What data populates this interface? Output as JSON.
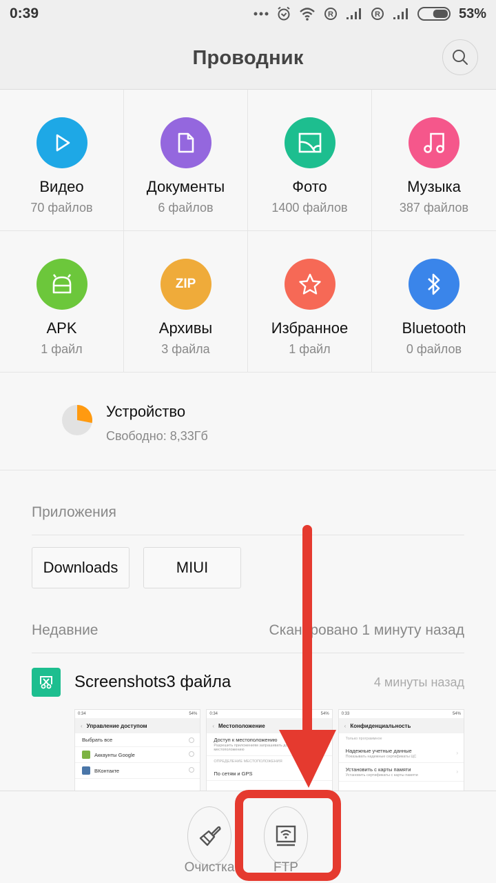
{
  "status_bar": {
    "time": "0:39",
    "battery_percent": "53%",
    "battery_level": 0.53,
    "icons": [
      "more-dots-icon",
      "alarm-icon",
      "wifi-icon",
      "roaming-icon",
      "signal-icon",
      "roaming-icon",
      "signal-icon",
      "battery-icon"
    ]
  },
  "header": {
    "title": "Проводник",
    "search_icon": "search-icon"
  },
  "categories": [
    {
      "name": "Видео",
      "count": "70 файлов",
      "icon": "play-icon",
      "color": "#1ea8e6"
    },
    {
      "name": "Документы",
      "count": "6 файлов",
      "icon": "document-icon",
      "color": "#9467de"
    },
    {
      "name": "Фото",
      "count": "1400 файлов",
      "icon": "photo-icon",
      "color": "#1dbe8f"
    },
    {
      "name": "Музыка",
      "count": "387 файлов",
      "icon": "music-icon",
      "color": "#f5578b"
    },
    {
      "name": "APK",
      "count": "1 файл",
      "icon": "android-icon",
      "color": "#6cc73b"
    },
    {
      "name": "Архивы",
      "count": "3 файла",
      "icon": "zip-icon",
      "icon_text": "ZIP",
      "color": "#efab3a"
    },
    {
      "name": "Избранное",
      "count": "1 файл",
      "icon": "star-icon",
      "color": "#f66956"
    },
    {
      "name": "Bluetooth",
      "count": "0 файлов",
      "icon": "bluetooth-icon",
      "color": "#3a85ea"
    }
  ],
  "device": {
    "name": "Устройство",
    "free": "Свободно: 8,33Гб",
    "used_fraction": 0.28,
    "used_color": "#ff9a10",
    "free_color": "#e2e2e2"
  },
  "apps": {
    "label": "Приложения",
    "items": [
      "Downloads",
      "MIUI"
    ]
  },
  "recent": {
    "label": "Недавние",
    "scanned": "Сканировано 1 минуту назад",
    "group": {
      "title": "Screenshots3 файла",
      "time": "4 минуты назад",
      "icon": "screenshot-icon"
    },
    "thumbnails": [
      {
        "time": "0:34",
        "battery": "54%",
        "title": "Управление доступом",
        "rows": [
          {
            "text": "Выбрать все"
          },
          {
            "text": "Аккаунты Google",
            "app_color": "#7cb342"
          },
          {
            "text": "ВКонтакте",
            "app_color": "#4a76a8"
          }
        ]
      },
      {
        "time": "0:34",
        "battery": "54%",
        "title": "Местоположение",
        "rows": [
          {
            "text": "Доступ к местоположению",
            "sub": "Разрешить приложениям запрашивать доступ к вашему местоположению"
          },
          {
            "caption": "ОПРЕДЕЛЕНИЕ МЕСТОПОЛОЖЕНИЯ"
          },
          {
            "text": "По сетям и GPS"
          }
        ]
      },
      {
        "time": "0:33",
        "battery": "54%",
        "title": "Конфиденциальность",
        "rows": [
          {
            "caption": "Только программное"
          },
          {
            "text": "Надежные учетные данные",
            "sub": "Показывать надежные сертификаты ЦС"
          },
          {
            "text": "Установить с карты памяти",
            "sub": "Установить сертификаты с карты памяти"
          }
        ]
      }
    ]
  },
  "bottom_bar": {
    "items": [
      {
        "label": "Очистка",
        "icon": "broom-icon"
      },
      {
        "label": "FTP",
        "icon": "ftp-icon"
      }
    ]
  },
  "annotation": {
    "color": "#e53a2f",
    "highlighted": "FTP"
  }
}
